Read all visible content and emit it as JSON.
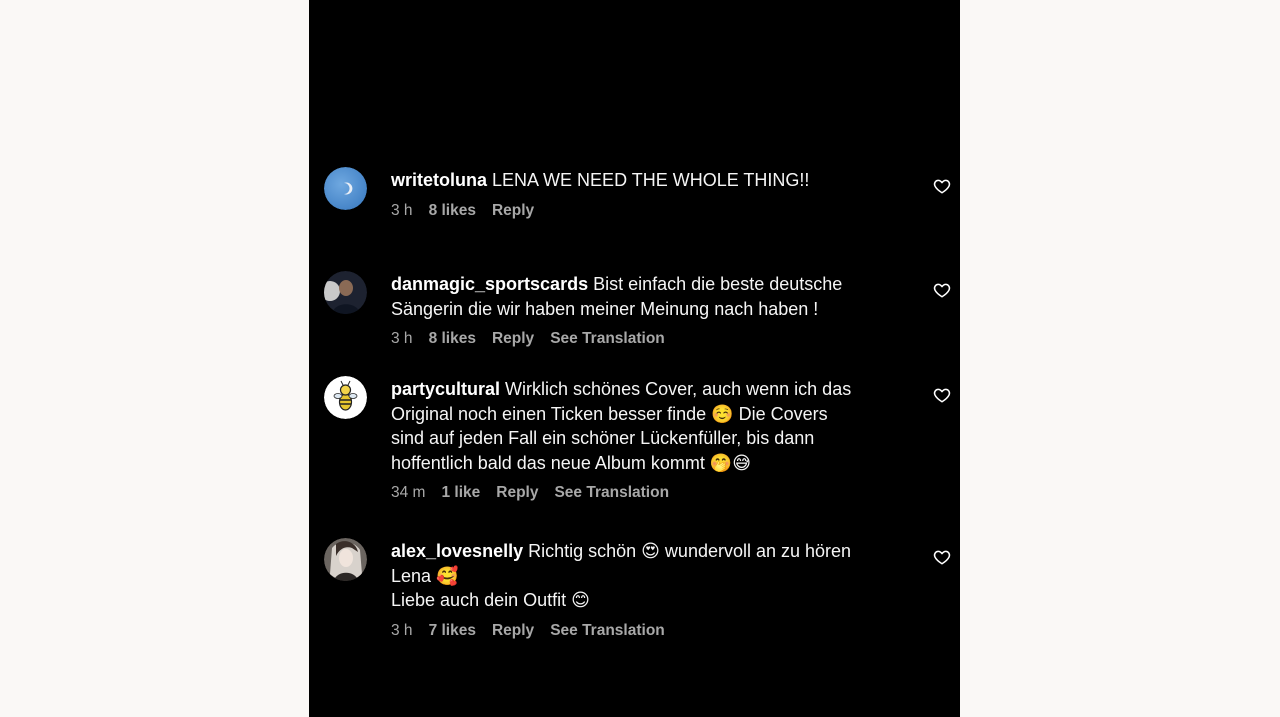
{
  "comments": [
    {
      "username": "writetoluna",
      "text": "LENA WE NEED THE WHOLE THING!!",
      "time": "3 h",
      "likes": "8 likes",
      "reply": "Reply",
      "translation": ""
    },
    {
      "username": "danmagic_sportscards",
      "text": "Bist einfach die beste deutsche Sängerin die wir haben meiner Meinung nach haben !",
      "time": "3 h",
      "likes": "8 likes",
      "reply": "Reply",
      "translation": "See Translation"
    },
    {
      "username": "partycultural",
      "text": "Wirklich schönes Cover, auch wenn ich das Original noch einen Ticken besser finde ☺️ Die Covers sind auf jeden Fall ein schöner Lückenfüller, bis dann hoffentlich bald das neue Album kommt 🤭😅",
      "time": "34 m",
      "likes": "1 like",
      "reply": "Reply",
      "translation": "See Translation"
    },
    {
      "username": "alex_lovesnelly",
      "text": "Richtig schön 😍 wundervoll an zu hören Lena 🥰\nLiebe auch dein Outfit 😊",
      "time": "3 h",
      "likes": "7 likes",
      "reply": "Reply",
      "translation": "See Translation"
    }
  ],
  "icons": {
    "like": "heart-outline-icon"
  },
  "colors": {
    "panel_background": "#000000",
    "page_background": "#faf8f6",
    "meta_text": "#a8a8a8"
  }
}
